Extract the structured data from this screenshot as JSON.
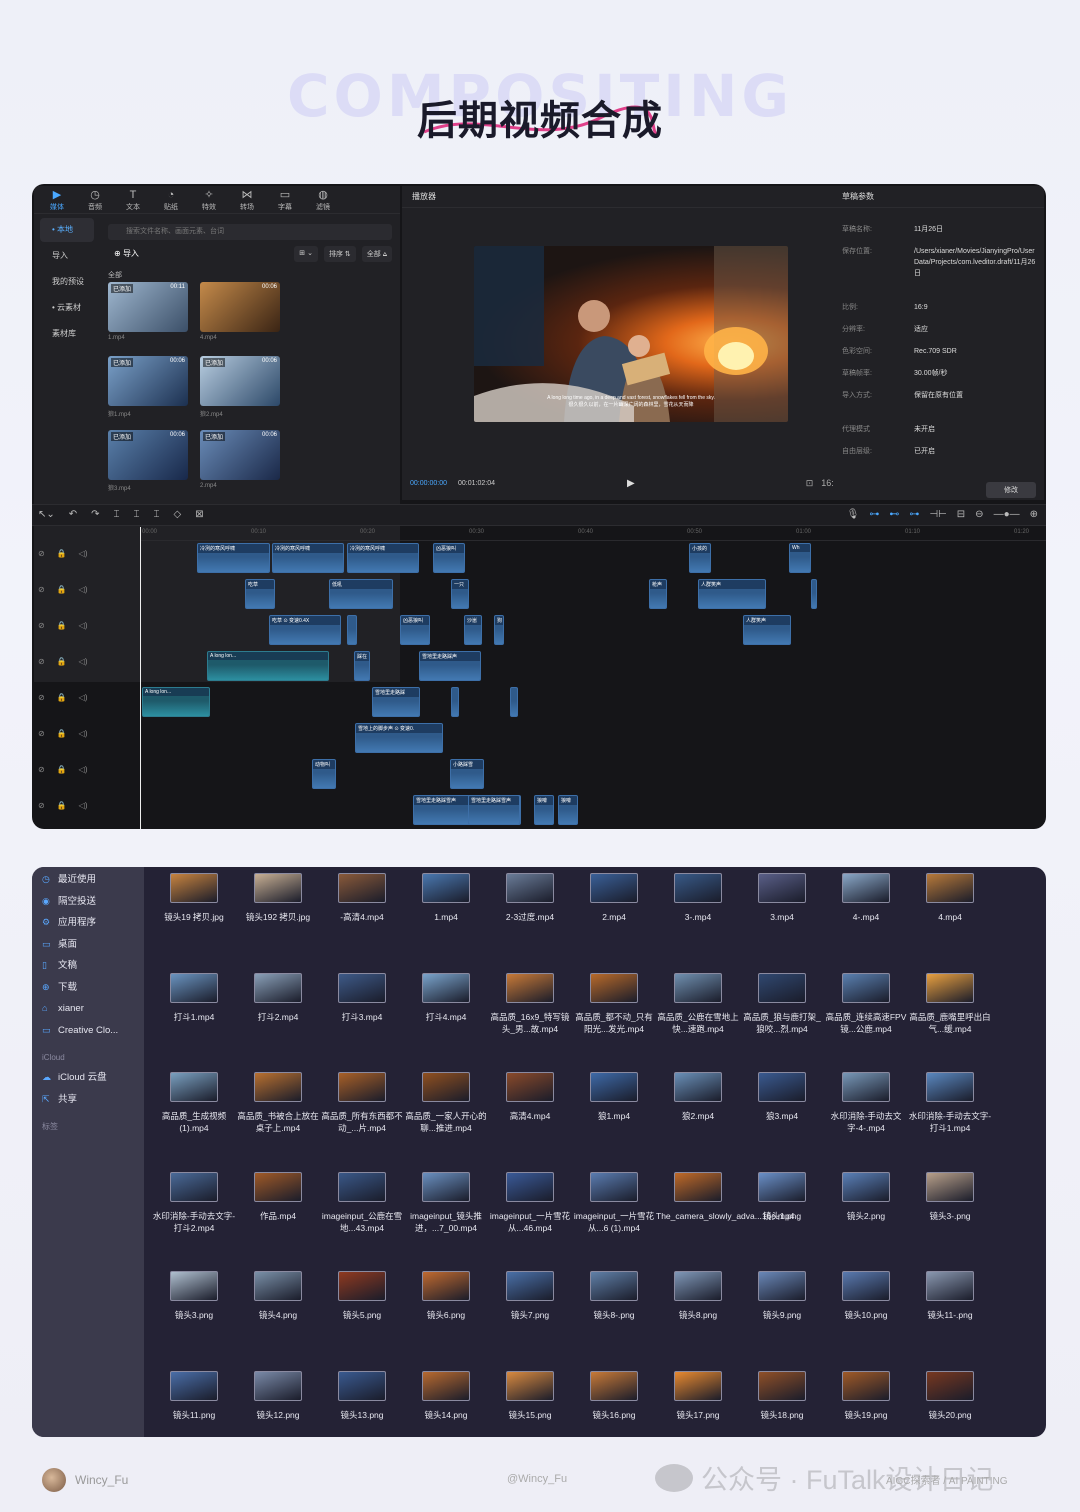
{
  "hero": {
    "bg_text": "COMPOSITING",
    "title": "后期视频合成"
  },
  "editor": {
    "tabs": [
      {
        "label": "媒体",
        "icon": "media-icon",
        "glyph": "▶"
      },
      {
        "label": "音频",
        "icon": "audio-icon",
        "glyph": "◷"
      },
      {
        "label": "文本",
        "icon": "text-icon",
        "glyph": "T"
      },
      {
        "label": "贴纸",
        "icon": "sticker-icon",
        "glyph": "◔"
      },
      {
        "label": "特效",
        "icon": "effects-icon",
        "glyph": "✧"
      },
      {
        "label": "转场",
        "icon": "transition-icon",
        "glyph": "⋈"
      },
      {
        "label": "字幕",
        "icon": "subtitle-icon",
        "glyph": "▭"
      },
      {
        "label": "滤镜",
        "icon": "filter-icon",
        "glyph": "◍"
      }
    ],
    "side": [
      "• 本地",
      "导入",
      "我的预设",
      "• 云素材",
      "素材库"
    ],
    "search_placeholder": "搜索文件名称、画面元素、台词",
    "import_label": "导入",
    "sort_buttons": [
      "⊞ ⌄",
      "排序 ⇅",
      "全部 ⩠"
    ],
    "all_label": "全部",
    "media": [
      {
        "name": "1.mp4",
        "tag": "已添加",
        "dur": "00:11",
        "colors": [
          "#9fb7cf",
          "#3b4f68"
        ]
      },
      {
        "name": "4.mp4",
        "tag": "",
        "dur": "00:06",
        "colors": [
          "#c48a4a",
          "#3a2414"
        ]
      },
      {
        "name": "狼1.mp4",
        "tag": "已添加",
        "dur": "00:06",
        "colors": [
          "#7aa0c8",
          "#1c3050"
        ]
      },
      {
        "name": "狼2.mp4",
        "tag": "已添加",
        "dur": "00:06",
        "colors": [
          "#b8cde0",
          "#2c4868"
        ]
      },
      {
        "name": "狼3.mp4",
        "tag": "已添加",
        "dur": "00:06",
        "colors": [
          "#5a80aa",
          "#18284a"
        ]
      },
      {
        "name": "2.mp4",
        "tag": "已添加",
        "dur": "00:06",
        "colors": [
          "#6a8cb8",
          "#1a2848"
        ]
      }
    ],
    "player": {
      "title": "播放器",
      "current": "00:00:00:00",
      "total": "00:01:02:04",
      "caption": "A long long time ago, in a deep and vast forest, snowflakes fell from the sky.\n很久很久以前，在一片幽深广阔的森林里，雪花从天而降"
    },
    "props": {
      "title": "草稿参数",
      "rows": [
        {
          "k": "草稿名称:",
          "v": "11月26日"
        },
        {
          "k": "保存位置:",
          "v": "/Users/xianer/Movies/JianyingPro/User Data/Projects/com.lveditor.draft/11月26日"
        },
        {
          "k": "比例:",
          "v": "16:9"
        },
        {
          "k": "分辨率:",
          "v": "适应"
        },
        {
          "k": "色彩空间:",
          "v": "Rec.709 SDR"
        },
        {
          "k": "草稿帧率:",
          "v": "30.00帧/秒"
        },
        {
          "k": "导入方式:",
          "v": "保留在原有位置"
        },
        {
          "k": "代理模式",
          "v": "未开启"
        },
        {
          "k": "自由层级:",
          "v": "已开启"
        }
      ],
      "modify": "修改"
    },
    "ruler": [
      "00:00",
      "00:10",
      "00:20",
      "00:30",
      "00:40",
      "00:50",
      "01:00",
      "01:10",
      "01:20"
    ],
    "track_icons": "⊘  🔒  ◁)",
    "clips": [
      [
        "冷冽的寒风呼啸",
        0
      ],
      [
        "冷冽的寒风呼啸",
        0
      ],
      [
        "冷冽的寒风呼啸",
        0
      ],
      [
        "凶恶狼叫",
        0
      ],
      [
        "小孩的",
        0
      ],
      [
        "Wh",
        0
      ],
      [
        "吃草",
        1
      ],
      [
        "低吼",
        1
      ],
      [
        "一只",
        1
      ],
      [
        "枪声",
        1
      ],
      [
        "人群笑声",
        1
      ],
      [
        "",
        1
      ],
      [
        "吃草  ⊙ 变速0.4X",
        2
      ],
      [
        "",
        2
      ],
      [
        "凶恶狼叫",
        2
      ],
      [
        "沙崽",
        2
      ],
      [
        "狗",
        2
      ],
      [
        "人群笑声",
        2
      ],
      [
        "A long lon...",
        3
      ],
      [
        "踩在",
        3
      ],
      [
        "雪地里走路踩声",
        3
      ],
      [
        "A long lon...",
        4
      ],
      [
        "雪地里走路踩",
        4
      ],
      [
        "",
        4
      ],
      [
        "",
        4
      ],
      [
        "雪地上的脚步声  ⊙ 变速0.",
        5
      ],
      [
        "动物叫",
        6
      ],
      [
        "小路踩雪",
        6
      ],
      [
        "雪地里走路踩雪声",
        7
      ],
      [
        "雪地里走路踩雪声",
        7
      ],
      [
        "狼嚎",
        7
      ],
      [
        "狼嚎",
        7
      ]
    ]
  },
  "finder": {
    "sidebar": [
      {
        "label": "最近使用",
        "icon": "clock-icon",
        "glyph": "◷"
      },
      {
        "label": "隔空投送",
        "icon": "airdrop-icon",
        "glyph": "◉"
      },
      {
        "label": "应用程序",
        "icon": "apps-icon",
        "glyph": "⚙"
      },
      {
        "label": "桌面",
        "icon": "desktop-icon",
        "glyph": "▭"
      },
      {
        "label": "文稿",
        "icon": "documents-icon",
        "glyph": "▯"
      },
      {
        "label": "下载",
        "icon": "download-icon",
        "glyph": "⊕"
      },
      {
        "label": "xianer",
        "icon": "home-icon",
        "glyph": "⌂"
      },
      {
        "label": "Creative Clo...",
        "icon": "folder-icon",
        "glyph": "▭"
      }
    ],
    "icloud_header": "iCloud",
    "icloud": [
      {
        "label": "iCloud 云盘",
        "icon": "cloud-icon",
        "glyph": "☁"
      },
      {
        "label": "共享",
        "icon": "shared-icon",
        "glyph": "⇱"
      }
    ],
    "tags_header": "标签",
    "files": [
      [
        "镜头19 拷贝.jpg",
        "#c8843f"
      ],
      [
        "镜头192 拷贝.jpg",
        "#c8b094"
      ],
      [
        "-高清4.mp4",
        "#8a5a3a"
      ],
      [
        "1.mp4",
        "#4a78b0"
      ],
      [
        "2-3过度.mp4",
        "#6a7c98"
      ],
      [
        "2.mp4",
        "#3a6098"
      ],
      [
        "3-.mp4",
        "#385a88"
      ],
      [
        "3.mp4",
        "#5a5f88"
      ],
      [
        "4-.mp4",
        "#8aa8c8"
      ],
      [
        "4.mp4",
        "#b87a3a"
      ],
      [
        "打斗1.mp4",
        "#6a94c0"
      ],
      [
        "打斗2.mp4",
        "#8aa0b8"
      ],
      [
        "打斗3.mp4",
        "#3e5a88"
      ],
      [
        "打斗4.mp4",
        "#7aa4cc"
      ],
      [
        "高品质_16x9_特写镜头_男...故.mp4",
        "#c87a38"
      ],
      [
        "高品质_都不动_只有阳光...发光.mp4",
        "#b86a2a"
      ],
      [
        "高品质_公鹿在雪地上快...速跑.mp4",
        "#7090b0"
      ],
      [
        "高品质_狼与鹿打架_狼咬...烈.mp4",
        "#304870"
      ],
      [
        "高品质_连续高速FPV镜...公鹿.mp4",
        "#5a80b0"
      ],
      [
        "高品质_鹿嘴里呼出白气...缓.mp4",
        "#e8a040"
      ],
      [
        "高品质_生成视频(1).mp4",
        "#7aa0c0"
      ],
      [
        "高品质_书被合上放在桌子上.mp4",
        "#b87030"
      ],
      [
        "高品质_所有东西都不动_...片.mp4",
        "#a86028"
      ],
      [
        "高品质_一家人开心的聊...推进.mp4",
        "#905020"
      ],
      [
        "高清4.mp4",
        "#8a4a2a"
      ],
      [
        "狼1.mp4",
        "#3e6aa8"
      ],
      [
        "狼2.mp4",
        "#6a90b8"
      ],
      [
        "狼3.mp4",
        "#3a5a90"
      ],
      [
        "水印消除-手动去文字-4-.mp4",
        "#7898b8"
      ],
      [
        "水印消除-手动去文字-打斗1.mp4",
        "#5a88c0"
      ],
      [
        "水印消除-手动去文字-打斗2.mp4",
        "#4a6a98"
      ],
      [
        "作品.mp4",
        "#a05a28"
      ],
      [
        "imageinput_公鹿在雪地...43.mp4",
        "#3a5888"
      ],
      [
        "imageinput_镜头推进，...7_00.mp4",
        "#6a90c0"
      ],
      [
        "imageinput_一片雪花从...46.mp4",
        "#3a5a98"
      ],
      [
        "imageinput_一片雪花从...6 (1).mp4",
        "#5a7cb0"
      ],
      [
        "The_camera_slowly_adva...16c.mp4",
        "#c06a28"
      ],
      [
        "镜头1.png",
        "#6a90c8"
      ],
      [
        "镜头2.png",
        "#5a80b8"
      ],
      [
        "镜头3-.png",
        "#b8a08a"
      ],
      [
        "镜头3.png",
        "#b0c0d0"
      ],
      [
        "镜头4.png",
        "#7a90a8"
      ],
      [
        "镜头5.png",
        "#903a20"
      ],
      [
        "镜头6.png",
        "#c06a30"
      ],
      [
        "镜头7.png",
        "#4a70a8"
      ],
      [
        "镜头8-.png",
        "#6080a8"
      ],
      [
        "镜头8.png",
        "#8098b8"
      ],
      [
        "镜头9.png",
        "#6a88b8"
      ],
      [
        "镜头10.png",
        "#5a7ab0"
      ],
      [
        "镜头11-.png",
        "#8a98b0"
      ],
      [
        "镜头11.png",
        "#4a6ea8"
      ],
      [
        "镜头12.png",
        "#7a8aa8"
      ],
      [
        "镜头13.png",
        "#3a5a90"
      ],
      [
        "镜头14.png",
        "#b86a30"
      ],
      [
        "镜头15.png",
        "#d88a40"
      ],
      [
        "镜头16.png",
        "#c87a38"
      ],
      [
        "镜头17.png",
        "#e88a30"
      ],
      [
        "镜头18.png",
        "#905028"
      ],
      [
        "镜头19.png",
        "#a05a28"
      ],
      [
        "镜头20.png",
        "#783820"
      ]
    ]
  },
  "footer": {
    "user": "Wincy_Fu",
    "handle": "@Wincy_Fu",
    "watermark": "公众号 · FuTalk设计日记",
    "wm2": "AIGC探索者 / AI PAINTING"
  }
}
